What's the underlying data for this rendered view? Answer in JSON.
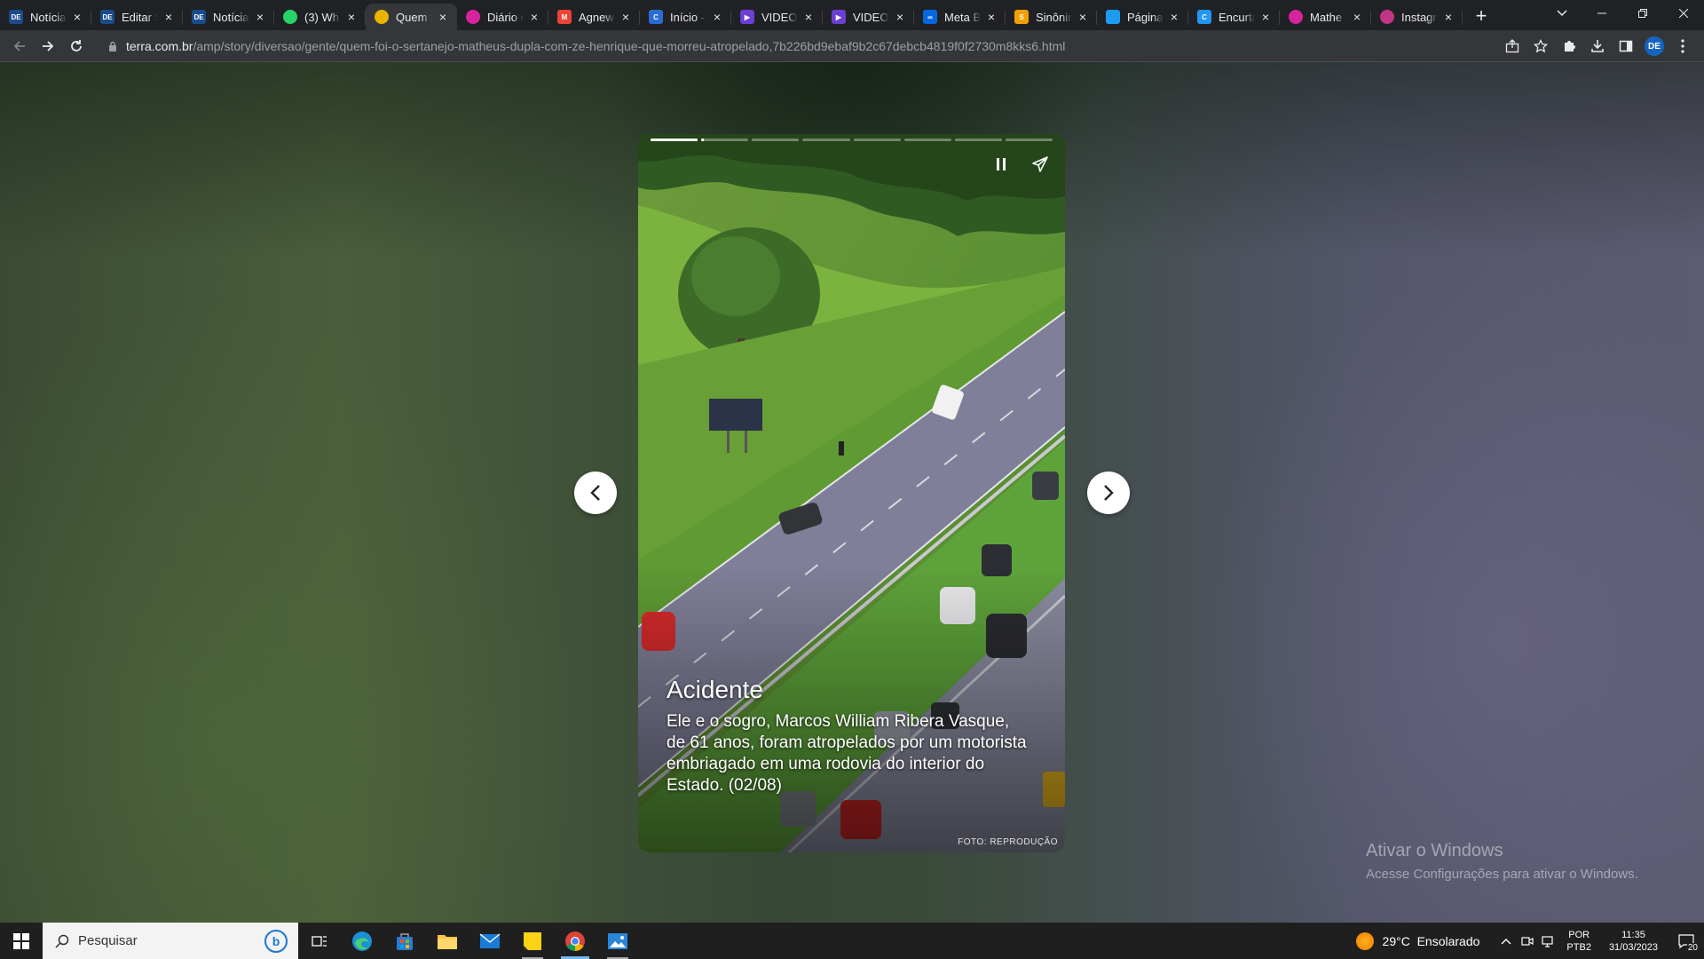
{
  "browser": {
    "tabs": [
      {
        "title": "Notícia",
        "favicon": "de-favicon",
        "favicon_text": "DE",
        "favicon_color": "#1a4b8c",
        "active": false
      },
      {
        "title": "Editar S",
        "favicon": "de-favicon",
        "favicon_text": "DE",
        "favicon_color": "#1a4b8c",
        "active": false
      },
      {
        "title": "Notícia",
        "favicon": "de-favicon",
        "favicon_text": "DE",
        "favicon_color": "#1a4b8c",
        "active": false
      },
      {
        "title": "(3) Wh",
        "favicon": "whatsapp-icon",
        "favicon_text": "",
        "favicon_color": "#25d366",
        "active": false
      },
      {
        "title": "Quem f",
        "favicon": "chrome-loading-icon",
        "favicon_text": "",
        "favicon_color": "#e8b400",
        "active": true
      },
      {
        "title": "Diário d",
        "favicon": "instagram-icon",
        "favicon_text": "",
        "favicon_color": "#d6249f",
        "active": false
      },
      {
        "title": "Agnew",
        "favicon": "gmail-icon",
        "favicon_text": "M",
        "favicon_color": "#ea4335",
        "active": false
      },
      {
        "title": "Início -",
        "favicon": "canva-icon",
        "favicon_text": "C",
        "favicon_color": "#2b6cd4",
        "active": false
      },
      {
        "title": "VIDEO",
        "favicon": "video-icon",
        "favicon_text": "▶",
        "favicon_color": "#6a3fd1",
        "active": false
      },
      {
        "title": "VIDEO",
        "favicon": "video-icon",
        "favicon_text": "▶",
        "favicon_color": "#6a3fd1",
        "active": false
      },
      {
        "title": "Meta B",
        "favicon": "meta-icon",
        "favicon_text": "∞",
        "favicon_color": "#0668e1",
        "active": false
      },
      {
        "title": "Sinônir",
        "favicon": "sinonimos-icon",
        "favicon_text": "S",
        "favicon_color": "#f29f05",
        "active": false
      },
      {
        "title": "Página",
        "favicon": "twitter-icon",
        "favicon_text": "",
        "favicon_color": "#1d9bf0",
        "active": false
      },
      {
        "title": "Encurta",
        "favicon": "encurtador-icon",
        "favicon_text": "C",
        "favicon_color": "#2196f3",
        "active": false
      },
      {
        "title": "Mathe",
        "favicon": "instagram-icon",
        "favicon_text": "",
        "favicon_color": "#d6249f",
        "active": false
      },
      {
        "title": "Instagr",
        "favicon": "instagram-icon",
        "favicon_text": "",
        "favicon_color": "#c13584",
        "active": false
      }
    ],
    "url_host": "terra.com.br",
    "url_path": "/amp/story/diversao/gente/quem-foi-o-sertanejo-matheus-dupla-com-ze-henrique-que-morreu-atropelado,7b226bd9ebaf9b2c67debcb4819f0f2730m8kks6.html",
    "profile_initials": "DE"
  },
  "story": {
    "segments": 8,
    "current_segment": 2,
    "current_progress": 0.05,
    "title": "Acidente",
    "text": "Ele e o sogro, Marcos William Ribera Vasque, de 61 anos, foram atropelados por um motorista embriagado em uma rodovia do interior do Estado. (02/08)",
    "credit": "FOTO: REPRODUÇÃO"
  },
  "watermark": {
    "title": "Ativar o Windows",
    "subtitle": "Acesse Configurações para ativar o Windows."
  },
  "taskbar": {
    "search_placeholder": "Pesquisar",
    "weather": "29°C  Ensolarado",
    "lang_line1": "POR",
    "lang_line2": "PTB2",
    "time": "11:35",
    "date": "31/03/2023",
    "notification_count": "20"
  }
}
